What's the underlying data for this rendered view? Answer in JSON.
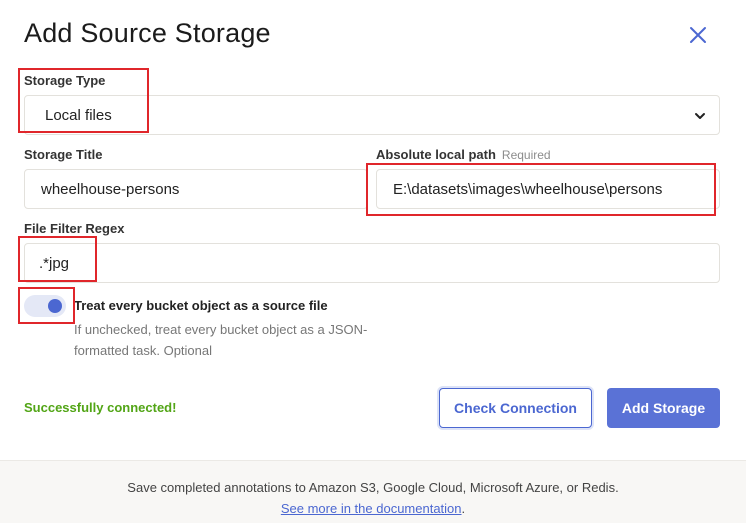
{
  "dialog": {
    "title": "Add Source Storage",
    "close_icon": "close-icon"
  },
  "storage_type": {
    "label": "Storage Type",
    "value": "Local files",
    "chevron_icon": "chevron-down-icon"
  },
  "storage_title": {
    "label": "Storage Title",
    "value": "wheelhouse-persons"
  },
  "local_path": {
    "label": "Absolute local path",
    "required": "Required",
    "value": "E:\\datasets\\images\\wheelhouse\\persons"
  },
  "file_filter": {
    "label": "File Filter Regex",
    "value": ".*jpg"
  },
  "treat_as_source": {
    "enabled": true,
    "title": "Treat every bucket object as a source file",
    "description": "If unchecked, treat every bucket object as a JSON-formatted task. Optional"
  },
  "status": {
    "text": "Successfully connected!",
    "color": "#52a516"
  },
  "actions": {
    "check_label": "Check Connection",
    "add_label": "Add Storage"
  },
  "footer": {
    "text": "Save completed annotations to Amazon S3, Google Cloud, Microsoft Azure, or Redis.",
    "link": "See more in the documentation",
    "link_suffix": "."
  },
  "colors": {
    "accent": "#4b67d1",
    "highlight": "#e0262b"
  }
}
